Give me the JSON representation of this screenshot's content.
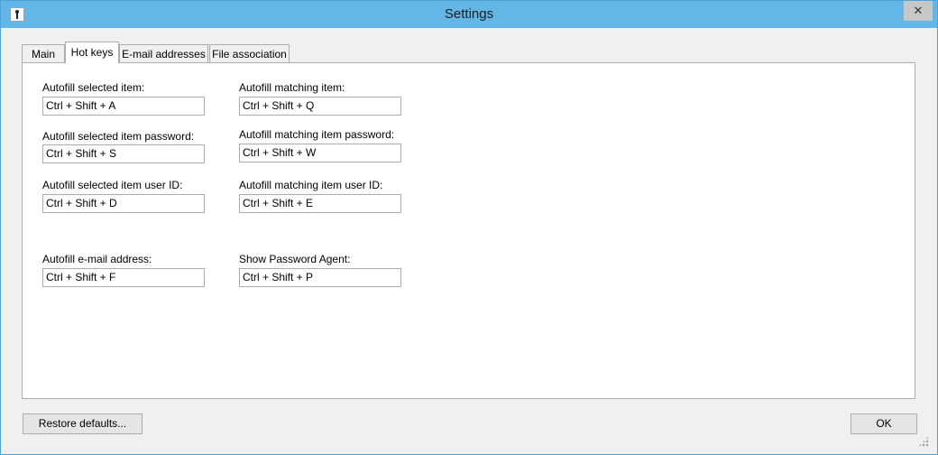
{
  "window": {
    "title": "Settings",
    "close_glyph": "✕"
  },
  "tabs": [
    {
      "label": "Main"
    },
    {
      "label": "Hot keys"
    },
    {
      "label": "E-mail addresses"
    },
    {
      "label": "File association"
    }
  ],
  "active_tab": "Hot keys",
  "hotkeys": {
    "autofill_selected_item": {
      "label": "Autofill selected item:",
      "value": "Ctrl + Shift + A"
    },
    "autofill_matching_item": {
      "label": "Autofill matching item:",
      "value": "Ctrl + Shift + Q"
    },
    "autofill_selected_password": {
      "label": "Autofill selected item password:",
      "value": "Ctrl + Shift + S"
    },
    "autofill_matching_password": {
      "label": "Autofill matching item password:",
      "value": "Ctrl + Shift + W"
    },
    "autofill_selected_userid": {
      "label": "Autofill selected item user ID:",
      "value": "Ctrl + Shift + D"
    },
    "autofill_matching_userid": {
      "label": "Autofill matching item user ID:",
      "value": "Ctrl + Shift + E"
    },
    "autofill_email": {
      "label": "Autofill e-mail address:",
      "value": "Ctrl + Shift + F"
    },
    "show_password_agent": {
      "label": "Show Password Agent:",
      "value": "Ctrl + Shift + P"
    }
  },
  "buttons": {
    "restore_defaults": "Restore defaults...",
    "ok": "OK"
  }
}
